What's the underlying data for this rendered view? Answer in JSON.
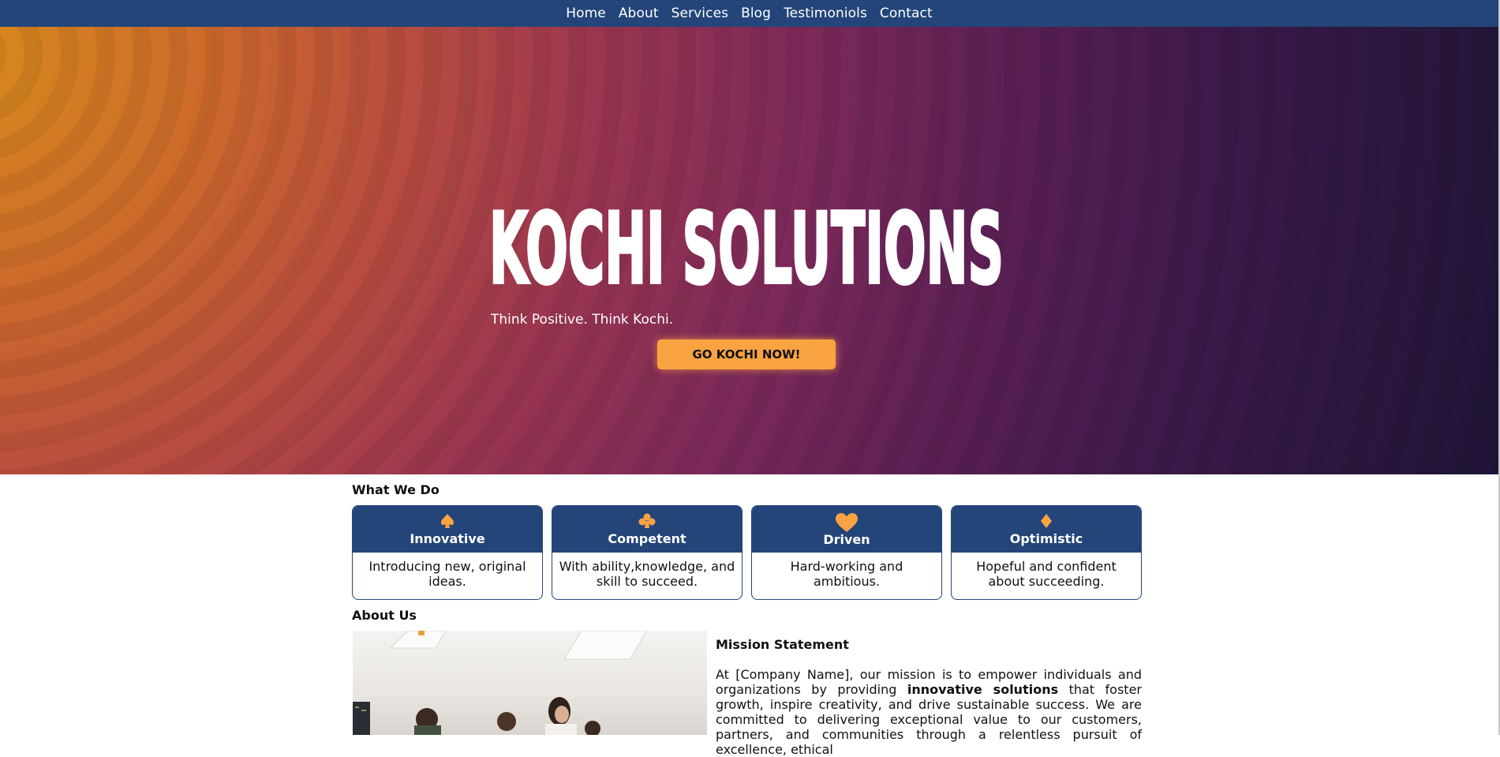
{
  "nav": {
    "items": [
      {
        "label": "Home"
      },
      {
        "label": "About"
      },
      {
        "label": "Services"
      },
      {
        "label": "Blog"
      },
      {
        "label": "Testimoniols"
      },
      {
        "label": "Contact"
      }
    ]
  },
  "hero": {
    "title": "KOCHI SOLUTIONS",
    "tagline": "Think Positive. Think Kochi.",
    "cta_label": "GO KOCHI NOW!"
  },
  "what_we_do": {
    "heading": "What We Do",
    "cards": [
      {
        "icon": "spade-icon",
        "title": "Innovative",
        "desc": "Introducing new, original ideas."
      },
      {
        "icon": "club-icon",
        "title": "Competent",
        "desc": "With ability,knowledge, and skill to succeed."
      },
      {
        "icon": "heart-icon",
        "title": "Driven",
        "desc": "Hard-working and ambitious."
      },
      {
        "icon": "diamond-icon",
        "title": "Optimistic",
        "desc": "Hopeful and confident about succeeding."
      }
    ]
  },
  "about": {
    "heading": "About Us",
    "mission_title": "Mission Statement",
    "mission_intro": "At [Company Name], our mission is to empower individuals and organizations by providing ",
    "mission_bold": "innovative solutions",
    "mission_rest": " that foster growth, inspire creativity, and drive sustainable success. We are committed to delivering exceptional value to our customers, partners, and communities through a relentless pursuit of excellence, ethical"
  },
  "colors": {
    "nav_bg": "#234579",
    "accent": "#f9a343",
    "card_head": "#234579"
  }
}
